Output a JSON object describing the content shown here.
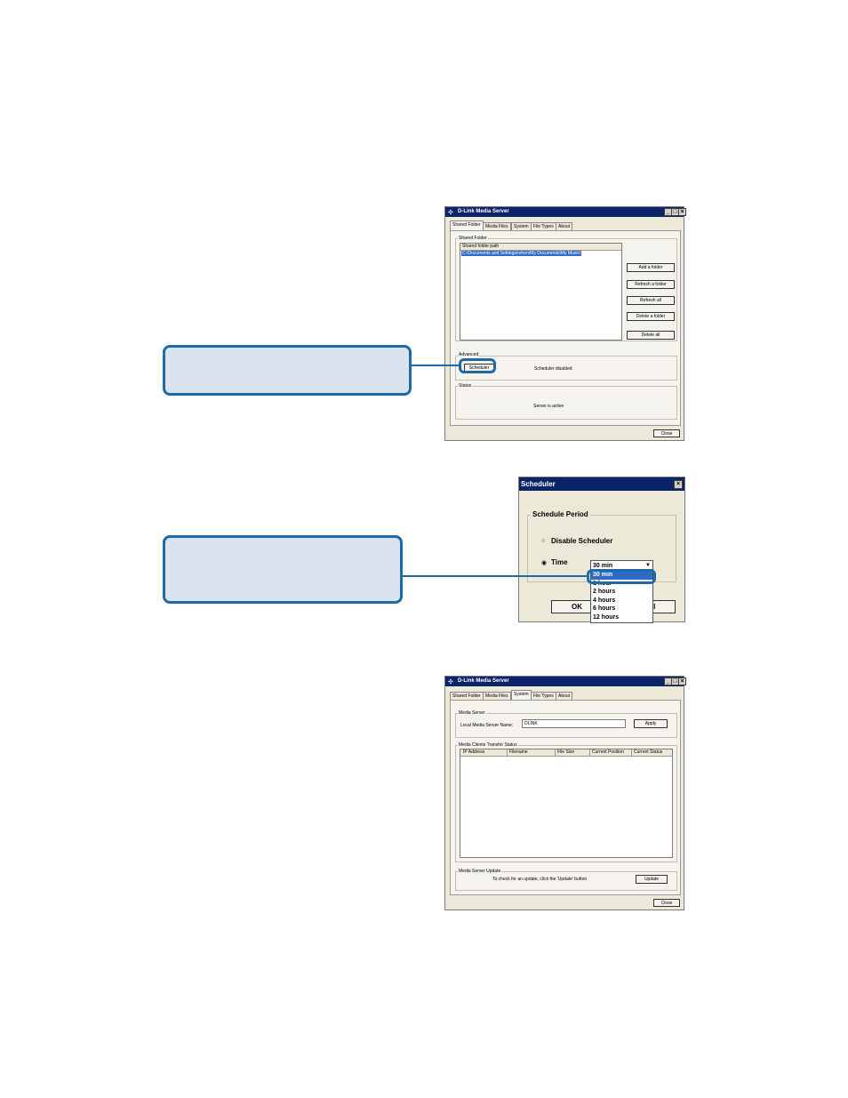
{
  "window1": {
    "title": "D-Link Media Server",
    "tabs": [
      "Shared Folder",
      "Media Files",
      "System",
      "File Types",
      "About"
    ],
    "shared_folder_label": "Shared Folder",
    "list_header": "Shared folder path",
    "list_item": "C:\\Documents and Settings\\rshen\\My Documents\\My Music\\",
    "buttons": {
      "add": "Add a folder",
      "refresh": "Refresh a folder",
      "refresh_all": "Refresh all",
      "delete": "Delete a folder",
      "delete_all": "Delete all"
    },
    "advanced_label": "Advanced",
    "scheduler_button": "Scheduler",
    "scheduler_status": "Scheduler disabled",
    "status_label": "Status",
    "status_text": "Server is active",
    "close": "Close"
  },
  "scheduler": {
    "title": "Scheduler",
    "group_label": "Schedule Period",
    "disable_label": "Disable Scheduler",
    "time_label": "Time",
    "selected": "30 min",
    "options": [
      "30 min",
      "1 hour",
      "2 hours",
      "4 hours",
      "6 hours",
      "12 hours"
    ],
    "ok": "OK",
    "cancel_partial": "el"
  },
  "window2": {
    "title": "D-Link Media Server",
    "tabs": [
      "Shared Folder",
      "Media Files",
      "System",
      "File Types",
      "About"
    ],
    "media_server_label": "Media Server",
    "server_name_label": "Local Media Server Name:",
    "server_name_value": "DLINK",
    "apply": "Apply",
    "transfer_label": "Media Clients Transfer Status",
    "columns": [
      "IP Address",
      "Filename",
      "File Size",
      "Current Position",
      "Current Status"
    ],
    "update_label": "Media Server Update",
    "update_text": "To check for an update, click the 'Update' button",
    "update": "Update",
    "close": "Close"
  }
}
